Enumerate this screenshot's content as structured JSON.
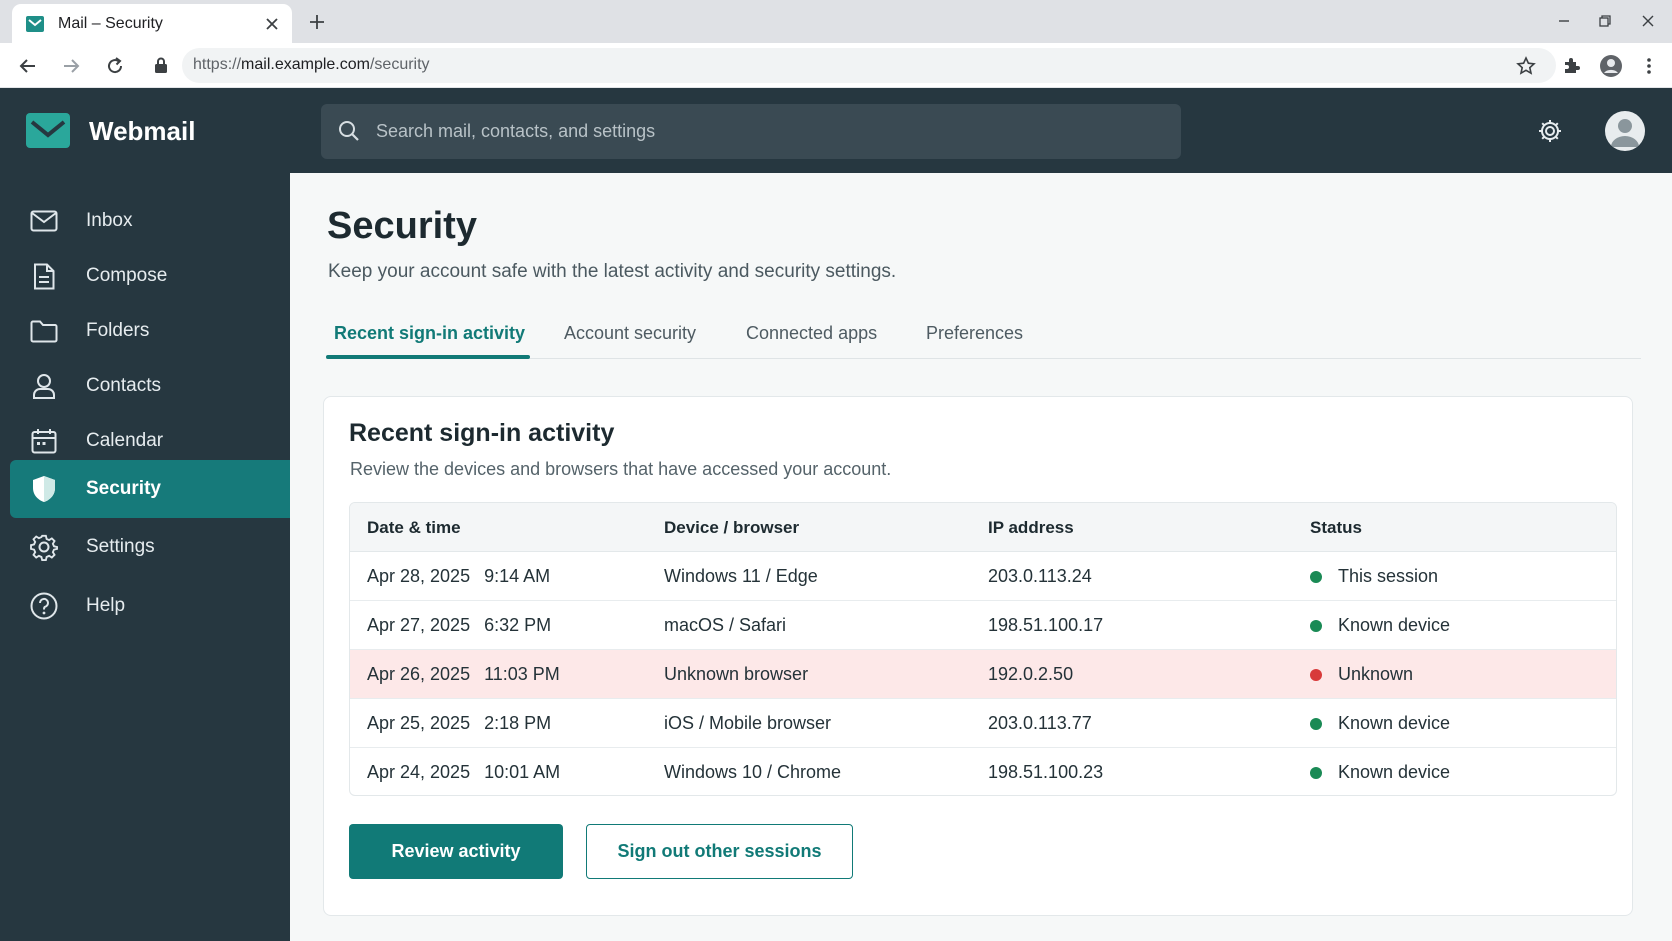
{
  "browser": {
    "tab_title": "Mail – Security",
    "url_scheme": "https://",
    "url_host": "mail.example.com",
    "url_path": "/security"
  },
  "header": {
    "brand": "Webmail",
    "search_placeholder": "Search mail, contacts, and settings"
  },
  "sidebar": {
    "items": [
      {
        "label": "Inbox",
        "icon": "mail-icon"
      },
      {
        "label": "Compose",
        "icon": "document-icon"
      },
      {
        "label": "Folders",
        "icon": "folder-icon"
      },
      {
        "label": "Contacts",
        "icon": "person-icon"
      },
      {
        "label": "Calendar",
        "icon": "calendar-icon"
      },
      {
        "label": "Security",
        "icon": "shield-icon",
        "active": true
      },
      {
        "label": "Settings",
        "icon": "gear-icon"
      },
      {
        "label": "Help",
        "icon": "help-icon"
      }
    ]
  },
  "page": {
    "title": "Security",
    "subtitle": "Keep your account safe with the latest activity and security settings.",
    "tabs": [
      {
        "label": "Recent sign-in activity",
        "active": true
      },
      {
        "label": "Account security"
      },
      {
        "label": "Connected apps"
      },
      {
        "label": "Preferences"
      }
    ]
  },
  "card": {
    "title": "Recent sign-in activity",
    "subtitle": "Review the devices and browsers that have accessed your account.",
    "columns": [
      "Date & time",
      "Device / browser",
      "IP address",
      "Status"
    ],
    "rows": [
      {
        "date": "Apr 28, 2025",
        "time": "9:14 AM",
        "device": "Windows 11 / Edge",
        "ip": "203.0.113.24",
        "status": "This session",
        "status_color": "#1a8a55",
        "alert": false
      },
      {
        "date": "Apr 27, 2025",
        "time": "6:32 PM",
        "device": "macOS / Safari",
        "ip": "198.51.100.17",
        "status": "Known device",
        "status_color": "#1a8a55",
        "alert": false
      },
      {
        "date": "Apr 26, 2025",
        "time": "11:03 PM",
        "device": "Unknown browser",
        "ip": "192.0.2.50",
        "status": "Unknown",
        "status_color": "#d83a3a",
        "alert": true
      },
      {
        "date": "Apr 25, 2025",
        "time": "2:18 PM",
        "device": "iOS / Mobile browser",
        "ip": "203.0.113.77",
        "status": "Known device",
        "status_color": "#1a8a55",
        "alert": false
      },
      {
        "date": "Apr 24, 2025",
        "time": "10:01 AM",
        "device": "Windows 10 / Chrome",
        "ip": "198.51.100.23",
        "status": "Known device",
        "status_color": "#1a8a55",
        "alert": false
      }
    ],
    "primary_button": "Review activity",
    "secondary_button": "Sign out other sessions"
  },
  "colors": {
    "sidebar_bg": "#263740",
    "accent": "#117a77",
    "active_nav": "#167a7a",
    "alert_row": "#fde8e8"
  }
}
